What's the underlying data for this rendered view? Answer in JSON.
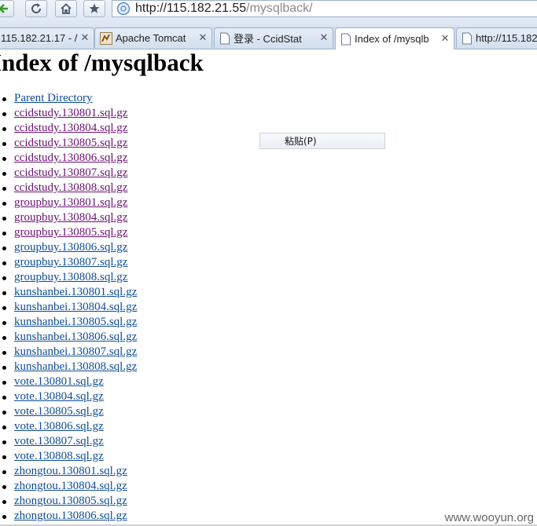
{
  "browser": {
    "address_bar": {
      "host": "http://115.182.21.55",
      "path": "/mysqlback/"
    },
    "tabs": [
      {
        "title": "115.182.21.17 - /",
        "favicon": "page-icon",
        "active": false
      },
      {
        "title": "Apache Tomcat",
        "favicon": "tomcat-icon",
        "active": false
      },
      {
        "title": "登录 - CcidStat",
        "favicon": "page-icon",
        "active": false
      },
      {
        "title": "Index of /mysqlb",
        "favicon": "page-icon",
        "active": true
      },
      {
        "title": "http://115.182",
        "favicon": "page-icon",
        "active": false
      }
    ],
    "close_glyph": "✕"
  },
  "page": {
    "heading": "Index of /mysqlback",
    "items": [
      {
        "text": "Parent Directory",
        "visited": false
      },
      {
        "text": "ccidstudy.130801.sql.gz",
        "visited": true
      },
      {
        "text": "ccidstudy.130804.sql.gz",
        "visited": true
      },
      {
        "text": "ccidstudy.130805.sql.gz",
        "visited": true
      },
      {
        "text": "ccidstudy.130806.sql.gz",
        "visited": true
      },
      {
        "text": "ccidstudy.130807.sql.gz",
        "visited": true
      },
      {
        "text": "ccidstudy.130808.sql.gz",
        "visited": true
      },
      {
        "text": "groupbuy.130801.sql.gz",
        "visited": true
      },
      {
        "text": "groupbuy.130804.sql.gz",
        "visited": true
      },
      {
        "text": "groupbuy.130805.sql.gz",
        "visited": true
      },
      {
        "text": "groupbuy.130806.sql.gz",
        "visited": false
      },
      {
        "text": "groupbuy.130807.sql.gz",
        "visited": false
      },
      {
        "text": "groupbuy.130808.sql.gz",
        "visited": false
      },
      {
        "text": "kunshanbei.130801.sql.gz",
        "visited": false
      },
      {
        "text": "kunshanbei.130804.sql.gz",
        "visited": false
      },
      {
        "text": "kunshanbei.130805.sql.gz",
        "visited": false
      },
      {
        "text": "kunshanbei.130806.sql.gz",
        "visited": false
      },
      {
        "text": "kunshanbei.130807.sql.gz",
        "visited": false
      },
      {
        "text": "kunshanbei.130808.sql.gz",
        "visited": false
      },
      {
        "text": "vote.130801.sql.gz",
        "visited": false
      },
      {
        "text": "vote.130804.sql.gz",
        "visited": false
      },
      {
        "text": "vote.130805.sql.gz",
        "visited": false
      },
      {
        "text": "vote.130806.sql.gz",
        "visited": false
      },
      {
        "text": "vote.130807.sql.gz",
        "visited": false
      },
      {
        "text": "vote.130808.sql.gz",
        "visited": false
      },
      {
        "text": "zhongtou.130801.sql.gz",
        "visited": false
      },
      {
        "text": "zhongtou.130804.sql.gz",
        "visited": false
      },
      {
        "text": "zhongtou.130805.sql.gz",
        "visited": false
      },
      {
        "text": "zhongtou.130806.sql.gz",
        "visited": false
      }
    ]
  },
  "context_menu": {
    "paste_label": "粘贴(P)"
  },
  "watermark": "www.wooyun.org",
  "colors": {
    "link": "#0f4c96",
    "visited_link": "#6b1172",
    "back_arrow": "#3a9a2a"
  }
}
